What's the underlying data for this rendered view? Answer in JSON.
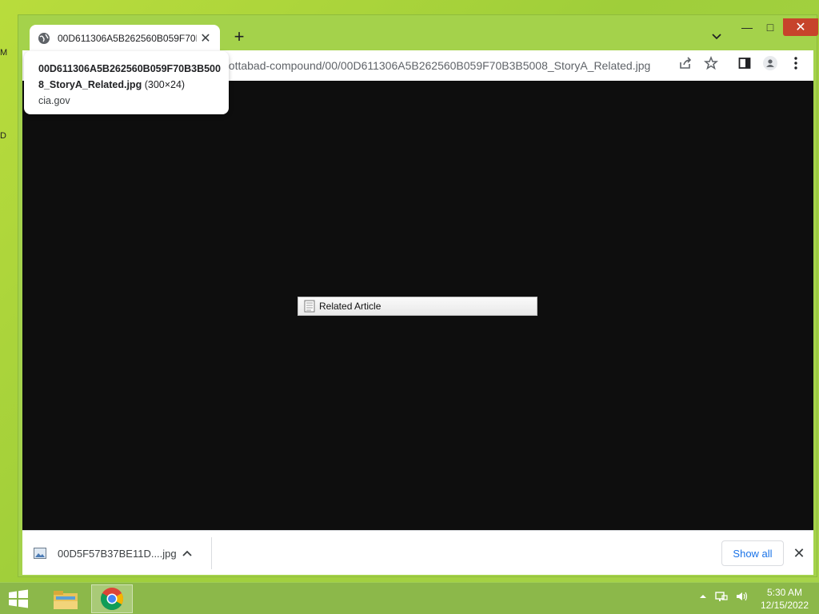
{
  "desktop": {
    "edge_letters": [
      "M",
      "D"
    ]
  },
  "browser": {
    "tab": {
      "title": "00D611306A5B262560B059F70B3B5008_StoryA_Related.jpg",
      "close_glyph": "✕"
    },
    "new_tab_glyph": "+",
    "window_controls": {
      "minimize": "—",
      "maximize": "□",
      "close": "✕"
    },
    "address_bar": {
      "url": "bottabad-compound/00/00D611306A5B262560B059F70B3B5008_StoryA_Related.jpg"
    },
    "tooltip": {
      "filename": "00D611306A5B262560B059F70B3B5008_StoryA_Related.jpg",
      "dimensions": "(300×24)",
      "host": "cia.gov"
    },
    "content": {
      "image_label": "Related Article"
    },
    "downloads_bar": {
      "file_name": "00D5F57B37BE11D....jpg",
      "show_all_label": "Show all",
      "close_glyph": "✕"
    }
  },
  "taskbar": {
    "time": "5:30 AM",
    "date": "12/15/2022"
  },
  "colors": {
    "accent": "#1a73e8",
    "close_button": "#c7432b",
    "desktop": "#a6d24a",
    "viewport": "#0e0e0e"
  },
  "icons": [
    "globe-icon",
    "search-tabs-icon",
    "share-icon",
    "star-icon",
    "side-panel-icon",
    "profile-icon",
    "menu-icon",
    "document-icon",
    "image-file-icon",
    "windows-start-icon",
    "file-explorer-icon",
    "chrome-icon",
    "network-icon",
    "volume-icon"
  ]
}
